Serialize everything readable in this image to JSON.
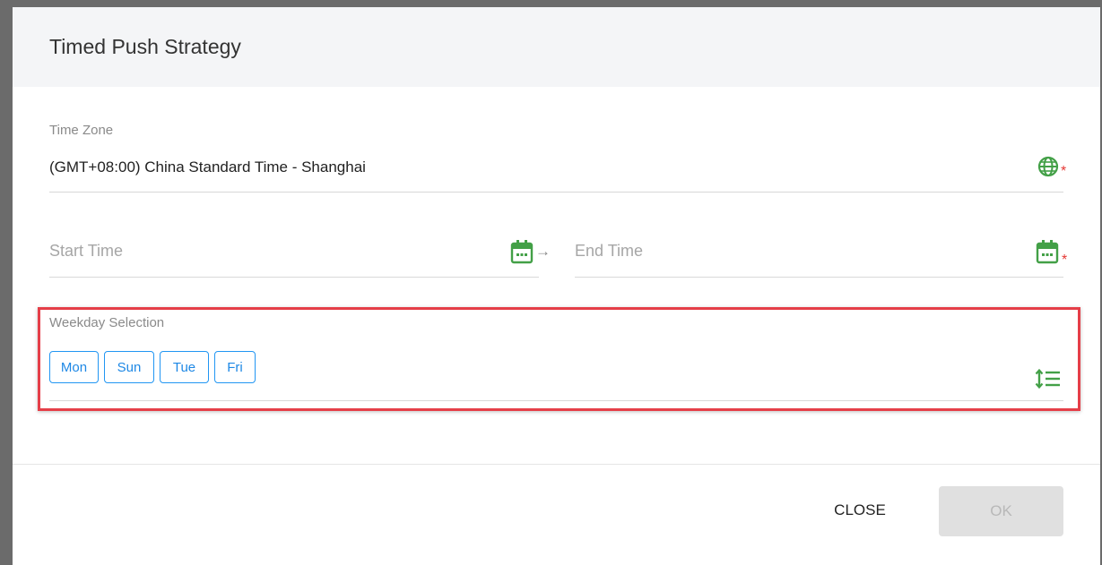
{
  "dialog": {
    "title": "Timed Push Strategy"
  },
  "time_zone": {
    "label": "Time Zone",
    "value": "(GMT+08:00) China Standard Time - Shanghai",
    "icon": "globe-icon",
    "required_mark": "*"
  },
  "time_range": {
    "start_placeholder": "Start Time",
    "end_placeholder": "End Time",
    "separator": "→",
    "icon": "calendar-icon",
    "required_mark": "*"
  },
  "weekday": {
    "label": "Weekday Selection",
    "selected": [
      "Mon",
      "Sun",
      "Tue",
      "Fri"
    ],
    "icon": "sort-list-icon"
  },
  "footer": {
    "close_label": "CLOSE",
    "ok_label": "OK"
  },
  "colors": {
    "icon_green": "#43a047",
    "chip_blue": "#2196f3",
    "required_red": "#e53935",
    "highlight_red": "#e53e48"
  }
}
